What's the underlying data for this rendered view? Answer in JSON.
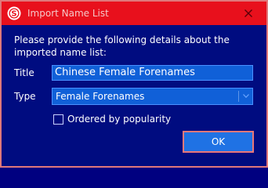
{
  "window": {
    "title": "Import Name List",
    "icon": "app-logo-s-icon",
    "close_icon": "close-icon",
    "colors": {
      "titlebar": "#e8101c",
      "body": "#000c80",
      "field": "#1060d8",
      "border": "#e0787a"
    }
  },
  "form": {
    "intro": "Please provide the following details about the imported name list:",
    "title_label": "Title",
    "title_value": "Chinese Female Forenames",
    "type_label": "Type",
    "type_value": "Female Forenames",
    "ordered_label": "Ordered by popularity",
    "ordered_checked": false
  },
  "buttons": {
    "ok_label": "OK"
  }
}
